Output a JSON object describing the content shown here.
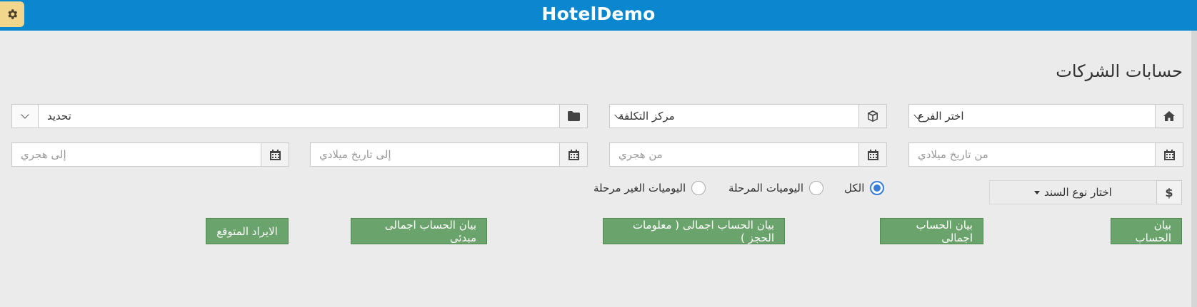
{
  "header": {
    "title": "HotelDemo"
  },
  "page": {
    "title": "حسابات الشركات"
  },
  "filters": {
    "branch": {
      "value": "اختر الفرع",
      "icon": "home-icon"
    },
    "cost_center": {
      "value": "مركز التكلفة",
      "icon": "cube-icon"
    },
    "selection": {
      "value": "تحديد",
      "icon": "folder-icon"
    },
    "from_gregorian": {
      "placeholder": "من تاريخ ميلادي",
      "icon": "calendar-icon"
    },
    "from_hijri": {
      "placeholder": "من هجري",
      "icon": "calendar-icon"
    },
    "to_gregorian": {
      "placeholder": "إلى تاريخ ميلادي",
      "icon": "calendar-icon"
    },
    "to_hijri": {
      "placeholder": "إلى هجري",
      "icon": "calendar-icon"
    }
  },
  "voucher_type": {
    "label": "اختار نوع السند",
    "icon_text": "$"
  },
  "journal_filter": {
    "options": [
      {
        "label": "الكل",
        "checked": true
      },
      {
        "label": "اليوميات المرحلة",
        "checked": false
      },
      {
        "label": "اليوميات الغير مرحلة",
        "checked": false
      }
    ]
  },
  "actions": {
    "account_statement": "بيان الحساب",
    "total_statement": "بيان الحساب اجمالى",
    "total_statement_booking": "بيان الحساب اجمالى ( معلومات الحجز )",
    "total_statement_initial": "بيان الحساب اجمالى مبدئى",
    "expected_revenue": "الايراد المتوقع"
  },
  "colors": {
    "header": "#0a87cf",
    "button": "#6aa36b",
    "gear": "#f2d68c",
    "radio": "#3a7bd5"
  }
}
